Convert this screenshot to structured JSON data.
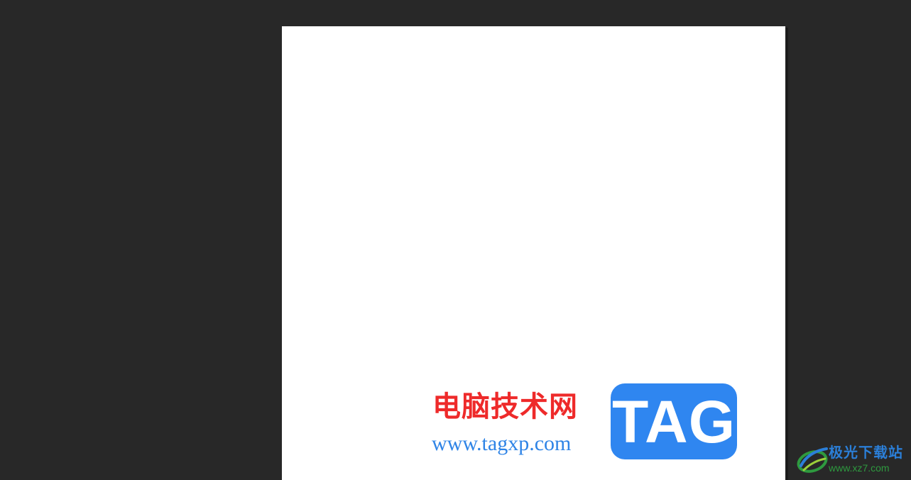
{
  "colors": {
    "background": "#282828",
    "canvas": "#ffffff",
    "watermark_red": "#ee2a2a",
    "watermark_blue": "#2f84e6",
    "tag_blue": "#2f86f0",
    "corner_green": "#2e9a3f",
    "corner_blue": "#2b7fd8"
  },
  "watermark": {
    "site_name": "电脑技术网",
    "url": "www.tagxp.com",
    "badge": "TAG"
  },
  "corner_logo": {
    "title": "极光下载站",
    "url": "www.xz7.com",
    "icon": "aurora-swoosh-icon"
  }
}
